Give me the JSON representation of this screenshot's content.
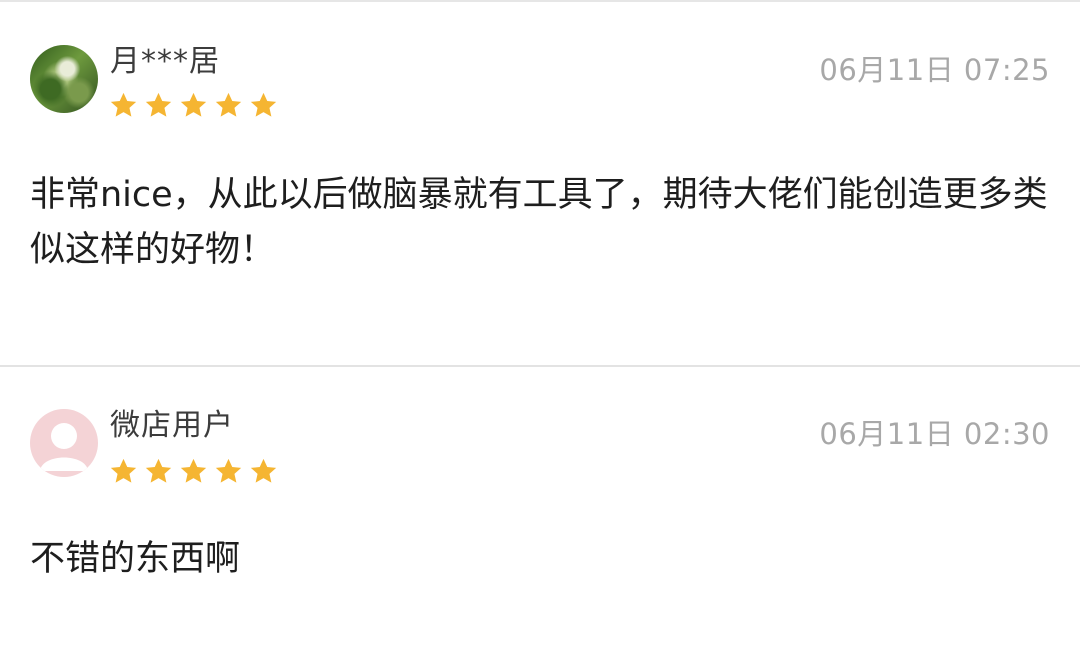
{
  "reviews": [
    {
      "username": "月***居",
      "avatar": "avatar-nature-photo",
      "rating": 5,
      "timestamp": "06月11日 07:25",
      "text": "非常nice，从此以后做脑暴就有工具了，期待大佬们能创造更多类似这样的好物！"
    },
    {
      "username": "微店用户",
      "avatar": "avatar-default-person",
      "rating": 5,
      "timestamp": "06月11日 02:30",
      "text": "不错的东西啊"
    }
  ],
  "colors": {
    "star": "#f5b532",
    "timestamp": "#a8a8a8",
    "divider": "#e3e3e3",
    "default_avatar_bg": "#f4d3d6"
  }
}
